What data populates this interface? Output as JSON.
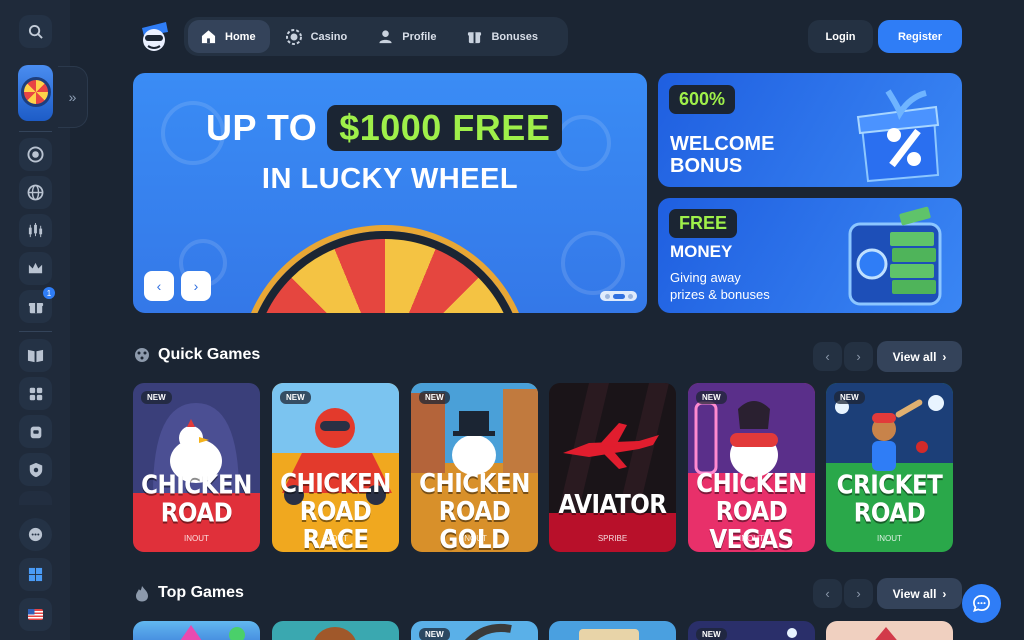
{
  "nav": {
    "items": [
      {
        "label": "Home",
        "icon": "home-icon",
        "active": true
      },
      {
        "label": "Casino",
        "icon": "chip-icon",
        "active": false
      },
      {
        "label": "Profile",
        "icon": "user-icon",
        "active": false
      },
      {
        "label": "Bonuses",
        "icon": "gift-icon",
        "active": false
      }
    ],
    "login_label": "Login",
    "register_label": "Register"
  },
  "sidebar": {
    "gift_badge": "1"
  },
  "hero": {
    "line1_prefix": "UP TO",
    "line1_amount": "$1000 FREE",
    "line2": "IN LUCKY WHEEL"
  },
  "promos": [
    {
      "tag": "600%",
      "title_line1": "WELCOME",
      "title_line2": "BONUS"
    },
    {
      "tag": "FREE",
      "title_line1": "MONEY",
      "sub_line1": "Giving away",
      "sub_line2": "prizes & bonuses"
    }
  ],
  "quick_games": {
    "title": "Quick Games",
    "view_all": "View all",
    "games": [
      {
        "name_line1": "CHICKEN",
        "name_line2": "ROAD",
        "provider": "INOUT",
        "new": "NEW"
      },
      {
        "name_line1": "CHICKEN",
        "name_line2": "ROAD RACE",
        "provider": "INOUT",
        "new": "NEW"
      },
      {
        "name_line1": "CHICKEN",
        "name_line2": "ROAD GOLD",
        "provider": "INOUT",
        "new": "NEW"
      },
      {
        "name_line1": "AVIATOR",
        "name_line2": "",
        "provider": "SPRIBE",
        "new": ""
      },
      {
        "name_line1": "CHICKEN",
        "name_line2": "ROAD VEGAS",
        "provider": "INOUT",
        "new": "NEW"
      },
      {
        "name_line1": "CRICKET",
        "name_line2": "ROAD",
        "provider": "INOUT",
        "new": "NEW"
      }
    ]
  },
  "top_games": {
    "title": "Top Games",
    "view_all": "View all",
    "new_label": "NEW"
  },
  "colors": {
    "accent": "#2f7df6",
    "bg": "#1b2533",
    "highlight_green": "#9ff04a"
  }
}
